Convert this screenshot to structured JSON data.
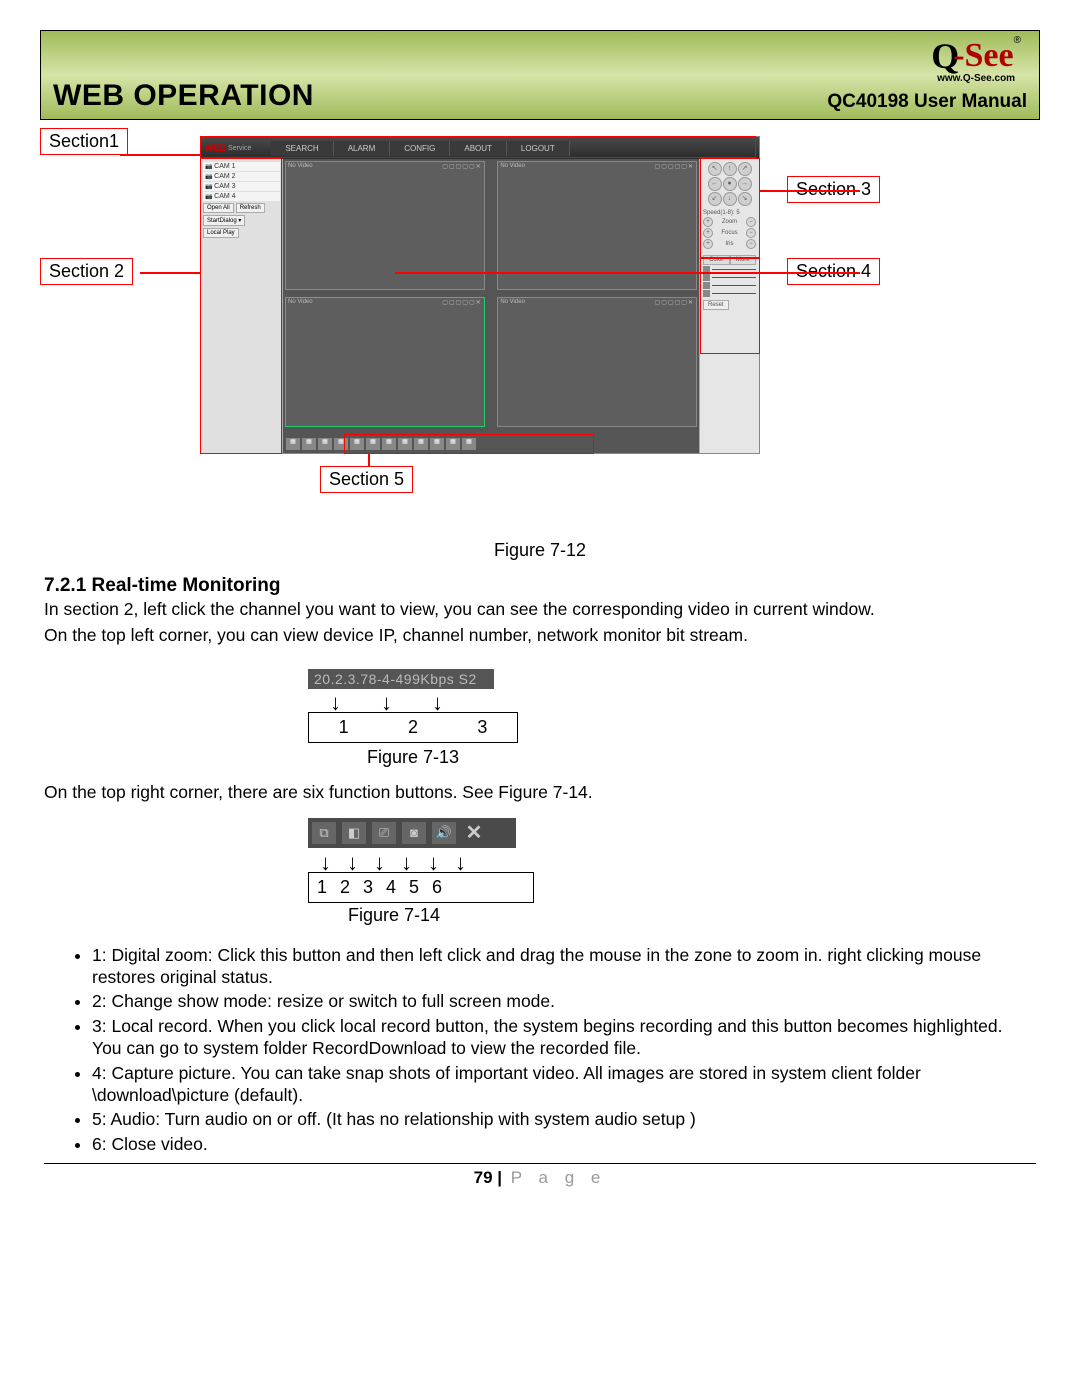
{
  "header": {
    "title": "WEB OPERATION",
    "manual": "QC40198 User Manual",
    "logo_text": "Q-See",
    "logo_url": "www.Q-See.com"
  },
  "section_labels": {
    "s1": "Section1",
    "s2": "Section 2",
    "s3": "Section 3",
    "s4": "Section 4",
    "s5": "Section 5"
  },
  "webshot": {
    "brand": "WEB",
    "brand_suffix": "Service",
    "menu": [
      "SEARCH",
      "ALARM",
      "CONFIG",
      "ABOUT",
      "LOGOUT"
    ],
    "cams": [
      "CAM 1",
      "CAM 2",
      "CAM 3",
      "CAM 4"
    ],
    "side_buttons": [
      "Open All",
      "Refresh"
    ],
    "side_extra": [
      "StartDialog ▾",
      "Local Play"
    ],
    "quad_label": "No Video",
    "ptz_speed": "Speed(1-8): 5",
    "ptz_rows": [
      "Zoom",
      "Focus",
      "Iris"
    ],
    "color_tabs": [
      "Color",
      "More"
    ],
    "reset": "Reset"
  },
  "fig12_caption": "Figure 7-12",
  "section_heading": "7.2.1  Real-time Monitoring",
  "para1": " In section 2, left click the channel you want to view, you can see the corresponding video in current window.",
  "para2": "On the top left corner, you can view device IP, channel number, network monitor bit stream.",
  "fig13": {
    "bar_text": "20.2.3.78-4-499Kbps S2",
    "nums": [
      "1",
      "2",
      "3"
    ],
    "caption": "Figure 7-13"
  },
  "para3": "On the top right corner, there are six function buttons. See Figure 7-14.",
  "fig14": {
    "nums": "1  2   3  4   5     6",
    "caption": "Figure 7-14"
  },
  "bullets": [
    "1: Digital zoom: Click this button and then left click and drag the mouse in the zone to zoom in. right clicking mouse restores original status.",
    "2: Change show mode: resize or switch to full screen mode.",
    "3: Local record. When you click local record button, the system begins recording and this button becomes highlighted. You can go to system folder RecordDownload to view the recorded file.",
    "4: Capture picture. You can take snap shots of important video. All images are stored in system client folder \\download\\picture (default).",
    "5: Audio: Turn audio on or off. (It has no relationship with system audio setup )",
    "6: Close video."
  ],
  "footer": {
    "page_num": "79",
    "page_word": "P a g e"
  }
}
